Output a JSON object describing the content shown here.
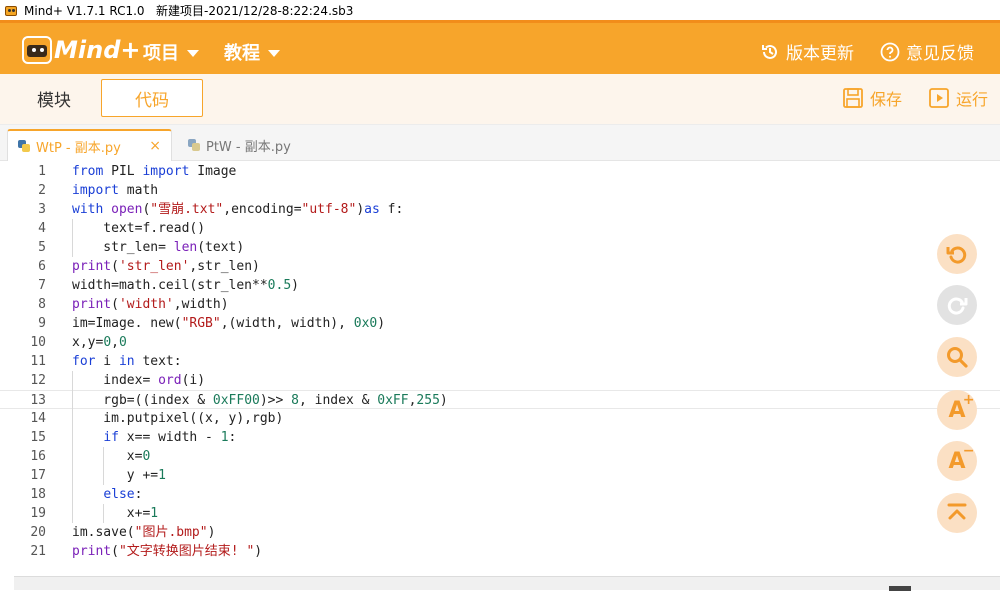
{
  "window": {
    "title": "Mind+ V1.7.1 RC1.0   新建项目-2021/12/28-8:22:24.sb3"
  },
  "header": {
    "logo_text": "Mind+",
    "menu_project": "项目",
    "menu_tutorial": "教程",
    "version_update": "版本更新",
    "feedback": "意见反馈"
  },
  "toolbar": {
    "tab_blocks": "模块",
    "tab_code": "代码",
    "save": "保存",
    "run": "运行"
  },
  "file_tabs": [
    {
      "label": "WtP - 副本.py",
      "active": true,
      "close": "×"
    },
    {
      "label": "PtW - 副本.py",
      "active": false
    }
  ],
  "editor": {
    "lines": [
      {
        "n": "1",
        "t": "from PIL import Image"
      },
      {
        "n": "2",
        "t": "import math"
      },
      {
        "n": "3",
        "t": "with open(\"雪崩.txt\",encoding=\"utf-8\")as f:"
      },
      {
        "n": "4",
        "t": "    text=f.read()"
      },
      {
        "n": "5",
        "t": "    str_len= len(text)"
      },
      {
        "n": "6",
        "t": "print('str_len',str_len)"
      },
      {
        "n": "7",
        "t": "width=math.ceil(str_len**0.5)"
      },
      {
        "n": "8",
        "t": "print('width',width)"
      },
      {
        "n": "9",
        "t": "im=Image. new(\"RGB\",(width, width), 0x0)"
      },
      {
        "n": "10",
        "t": "x,y=0,0"
      },
      {
        "n": "11",
        "t": "for i in text:"
      },
      {
        "n": "12",
        "t": "    index= ord(i)"
      },
      {
        "n": "13",
        "t": "    rgb=((index & 0xFF00)>> 8, index & 0xFF,255)"
      },
      {
        "n": "14",
        "t": "    im.putpixel((x, y),rgb)"
      },
      {
        "n": "15",
        "t": "    if x== width - 1:"
      },
      {
        "n": "16",
        "t": "       x=0"
      },
      {
        "n": "17",
        "t": "       y +=1"
      },
      {
        "n": "18",
        "t": "    else:"
      },
      {
        "n": "19",
        "t": "       x+=1"
      },
      {
        "n": "20",
        "t": "im.save(\"图片.bmp\")"
      },
      {
        "n": "21",
        "t": "print(\"文字转换图片结束! \")"
      }
    ]
  },
  "side_buttons": [
    "undo-icon",
    "redo-icon",
    "search-icon",
    "font-increase-icon",
    "font-decrease-icon",
    "scroll-top-icon"
  ],
  "colors": {
    "accent": "#f7a52b",
    "keyword": "#1a3fd6",
    "builtin": "#7a20b8",
    "string": "#b31b1b",
    "number": "#1a7a5a"
  }
}
